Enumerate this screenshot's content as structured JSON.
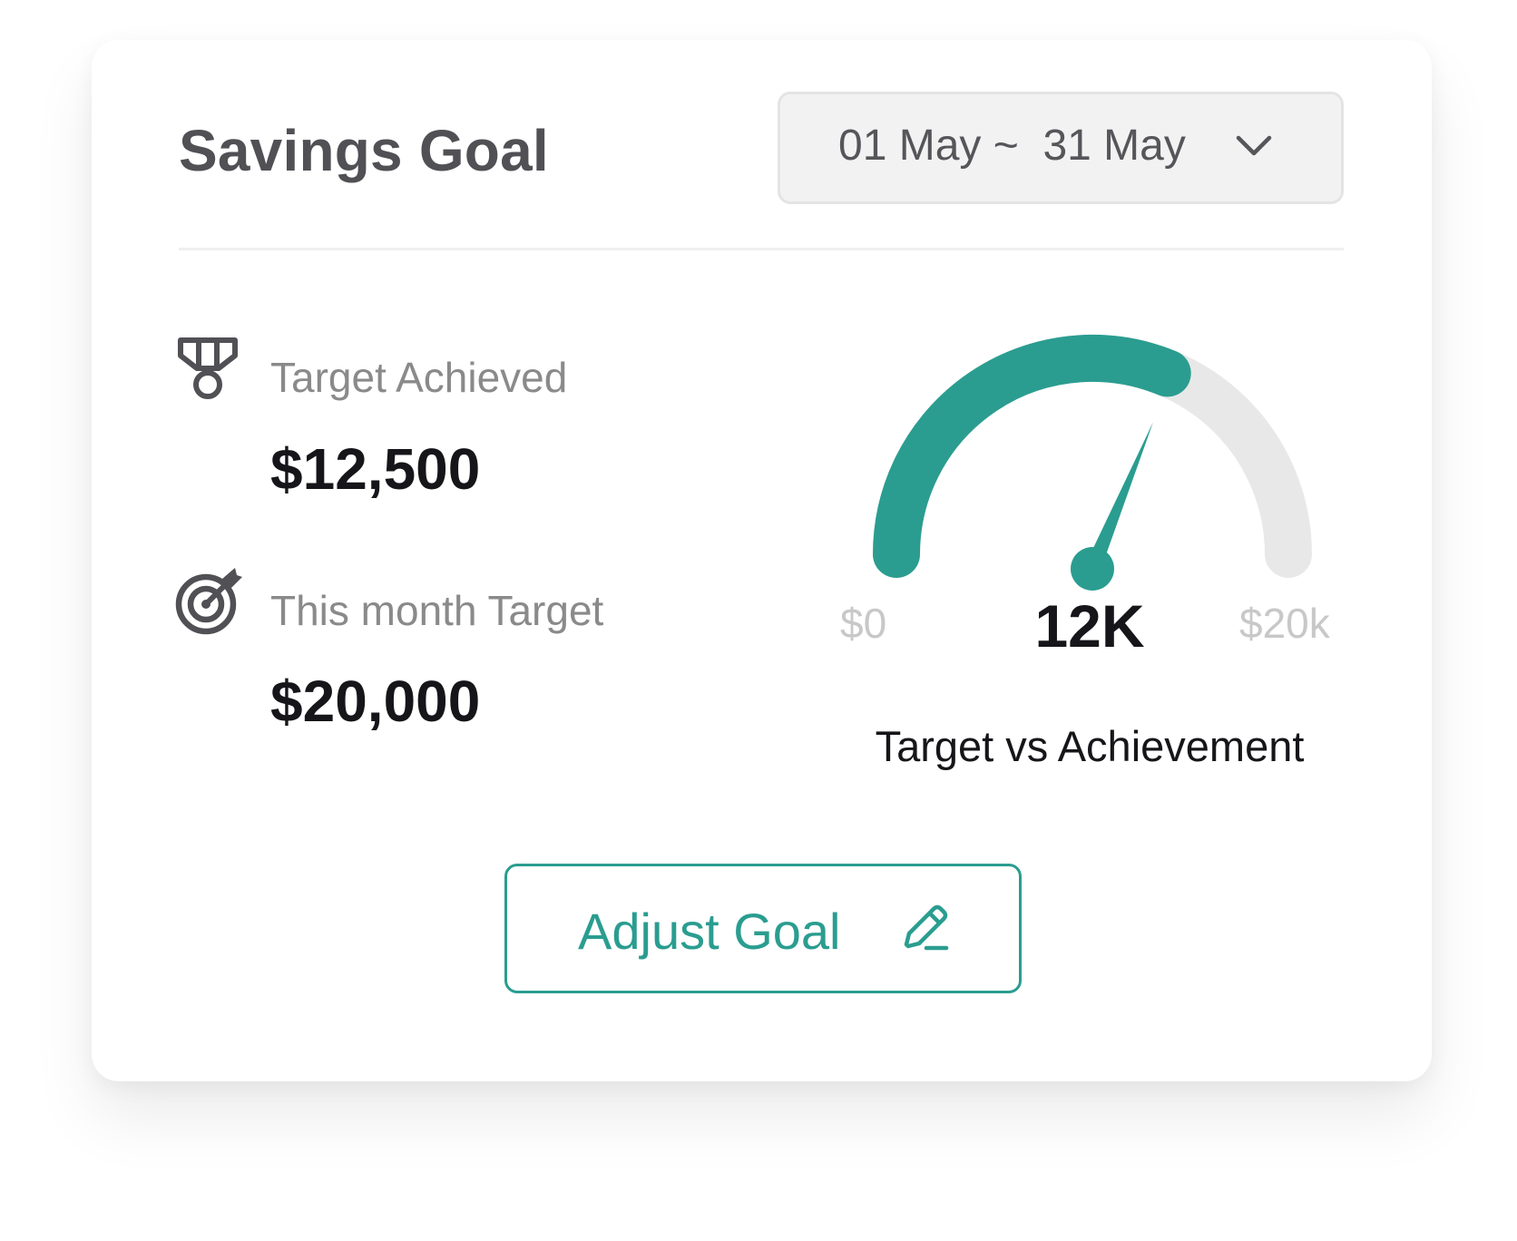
{
  "header": {
    "title": "Savings Goal",
    "date_range": "01 May ~  31 May",
    "dropdown_icon": "chevron-down-icon"
  },
  "stats": {
    "achieved": {
      "icon": "medal-icon",
      "label": "Target Achieved",
      "value": "$12,500"
    },
    "target": {
      "icon": "target-icon",
      "label": "This month Target",
      "value": "$20,000"
    }
  },
  "gauge": {
    "min_label": "$0",
    "max_label": "$20k",
    "center_label": "12K",
    "caption": "Target vs Achievement",
    "min": 0,
    "max": 20000,
    "value": 12500,
    "fill_color": "#2a9d90",
    "track_color": "#e8e8e8"
  },
  "actions": {
    "adjust_label": "Adjust Goal",
    "adjust_icon": "pencil-icon"
  },
  "colors": {
    "accent": "#2a9d90",
    "title_text": "#505055",
    "muted_text": "#8a8a8a"
  }
}
